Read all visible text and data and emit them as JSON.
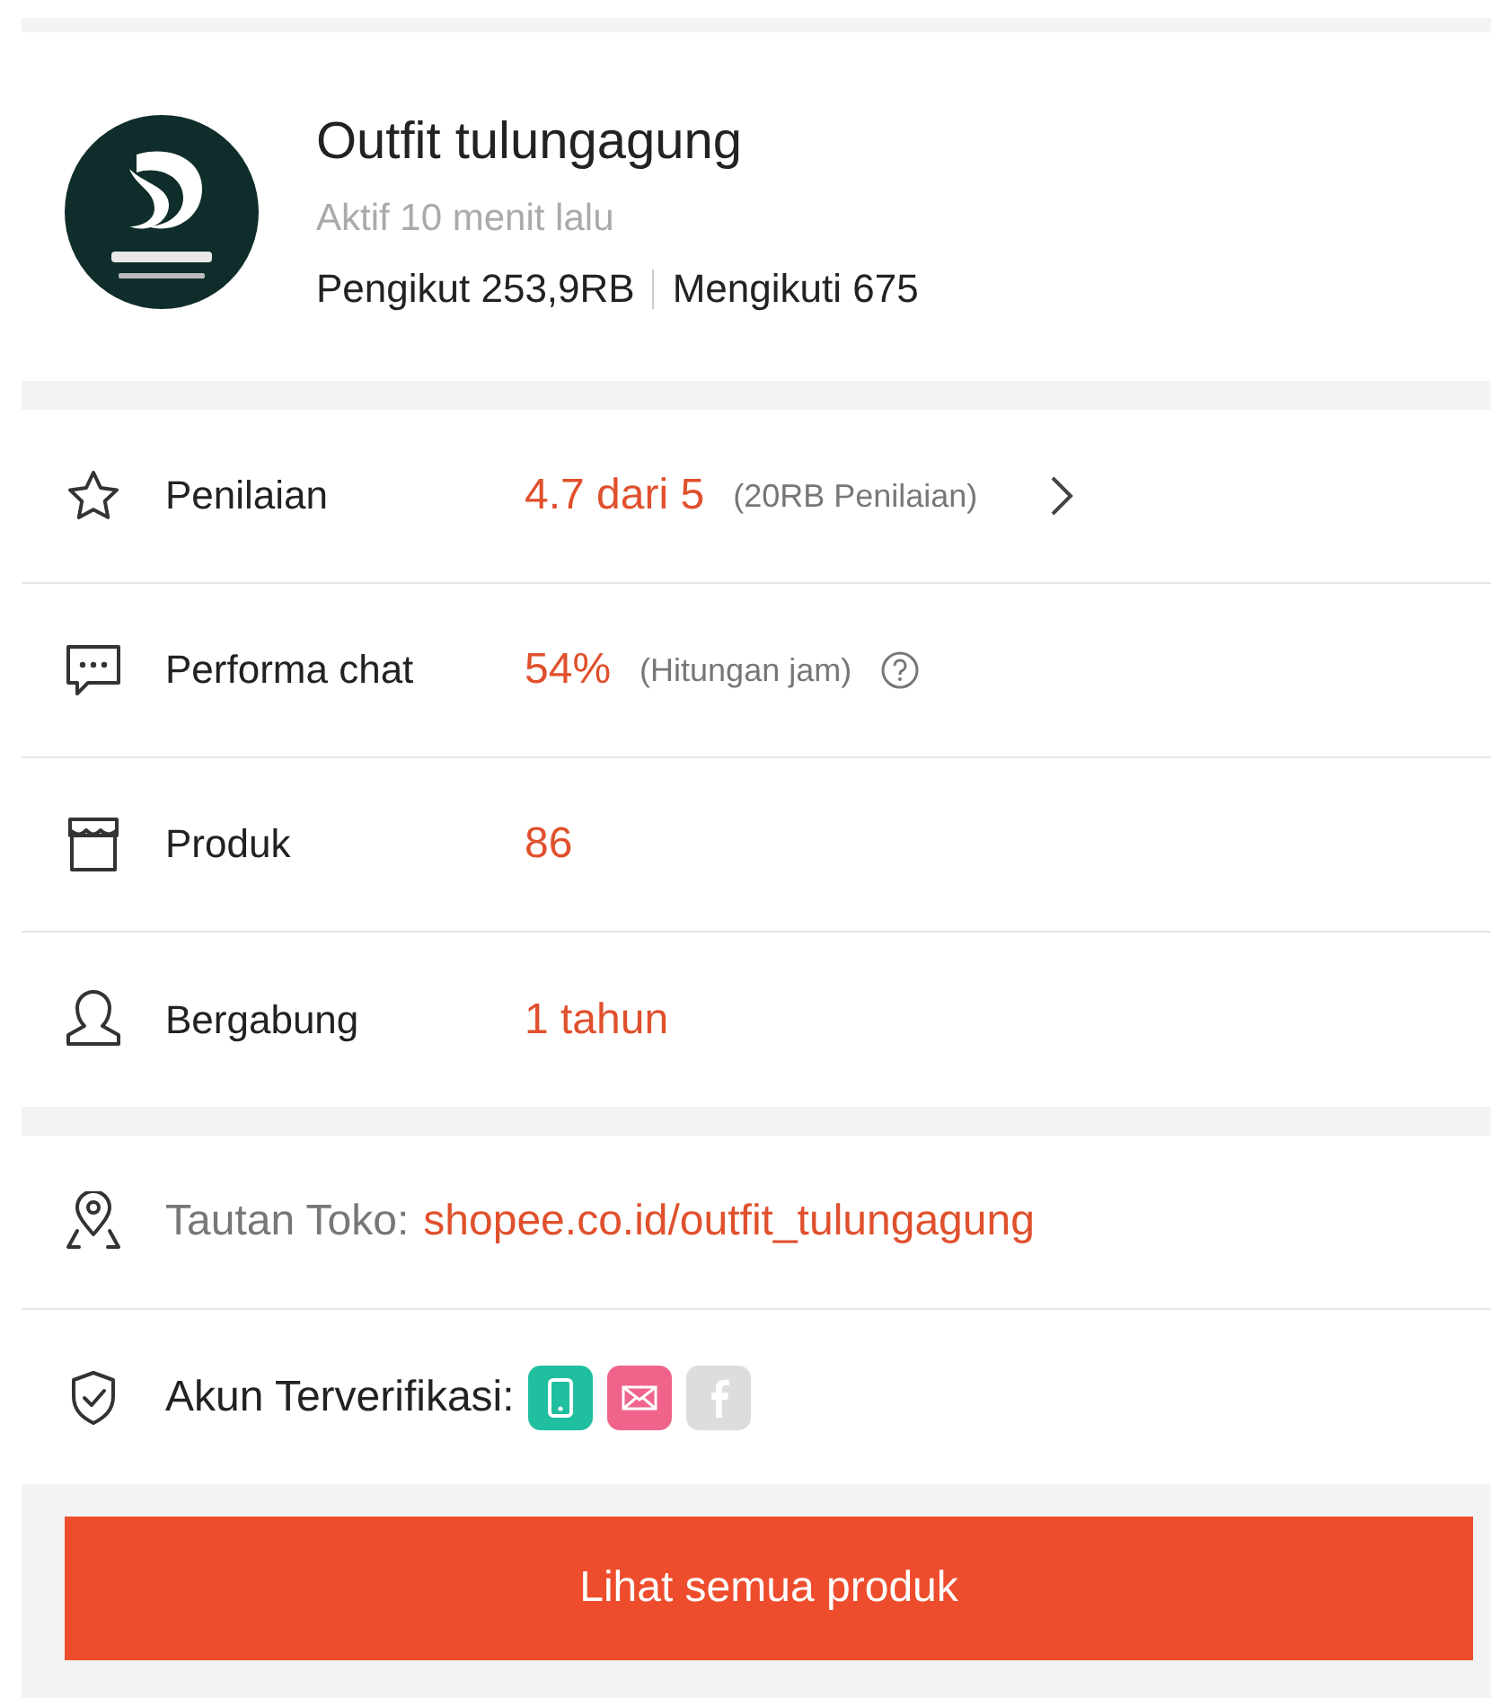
{
  "shop": {
    "name": "Outfit tulungagung",
    "status": "Aktif 10 menit lalu",
    "followers": "Pengikut 253,9RB",
    "following": "Mengikuti 675"
  },
  "stats": [
    {
      "kind": "rating",
      "label": "Penilaian",
      "value": "4.7 dari 5",
      "note": "(20RB Penilaian)"
    },
    {
      "kind": "chat",
      "label": "Performa chat",
      "value": "54%",
      "note": "(Hitungan jam)"
    },
    {
      "kind": "products",
      "label": "Produk",
      "value": "86"
    },
    {
      "kind": "joined",
      "label": "Bergabung",
      "value": "1 tahun"
    }
  ],
  "link": {
    "label": "Tautan Toko:",
    "url": "shopee.co.id/outfit_tulungagung"
  },
  "verified": {
    "label": "Akun Terverifikasi:",
    "accounts": [
      {
        "kind": "phone",
        "verified": true,
        "color": "#1fbf9f"
      },
      {
        "kind": "email",
        "verified": true,
        "color": "#f0648c"
      },
      {
        "kind": "facebook",
        "verified": false
      }
    ]
  },
  "button": "Lihat semua produk"
}
